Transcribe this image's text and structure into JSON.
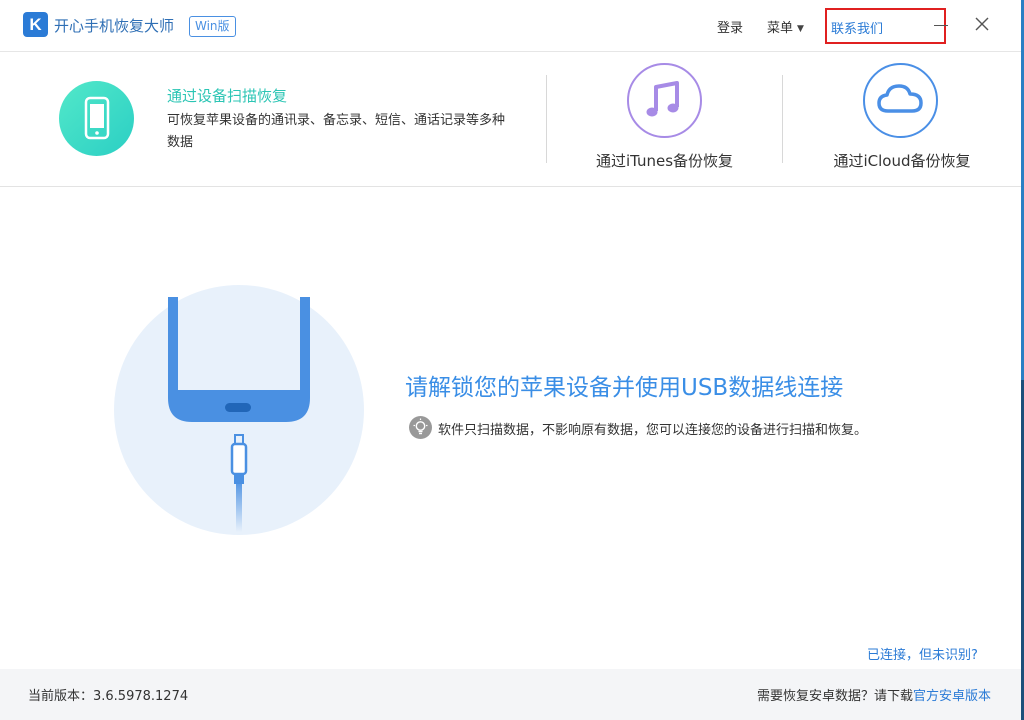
{
  "app": {
    "logo_letter": "K",
    "title": "开心手机恢复大师",
    "badge": "Win版"
  },
  "header": {
    "login_label": "登录",
    "menu_label": "菜单",
    "contact_label": "联系我们",
    "accent_color": "#2b7bd6",
    "highlight_color": "#e02020"
  },
  "modes": {
    "device": {
      "title": "通过设备扫描恢复",
      "description": "可恢复苹果设备的通讯录、备忘录、短信、通话记录等多种数据",
      "icon": "phone-icon",
      "color": "#2bcfc4"
    },
    "itunes": {
      "label": "通过iTunes备份恢复",
      "icon": "music-note-icon",
      "color": "#a78be6"
    },
    "icloud": {
      "label": "通过iCloud备份恢复",
      "icon": "cloud-icon",
      "color": "#4a8fe6"
    }
  },
  "main": {
    "headline": "请解锁您的苹果设备并使用USB数据线连接",
    "tip": "软件只扫描数据，不影响原有数据，您可以连接您的设备进行扫描和恢复。",
    "connected_link": "已连接，但未识别?"
  },
  "footer": {
    "version": "当前版本：3.6.5978.1274",
    "android_prompt": "需要恢复安卓数据？请下载",
    "android_link": "官方安卓版本"
  }
}
